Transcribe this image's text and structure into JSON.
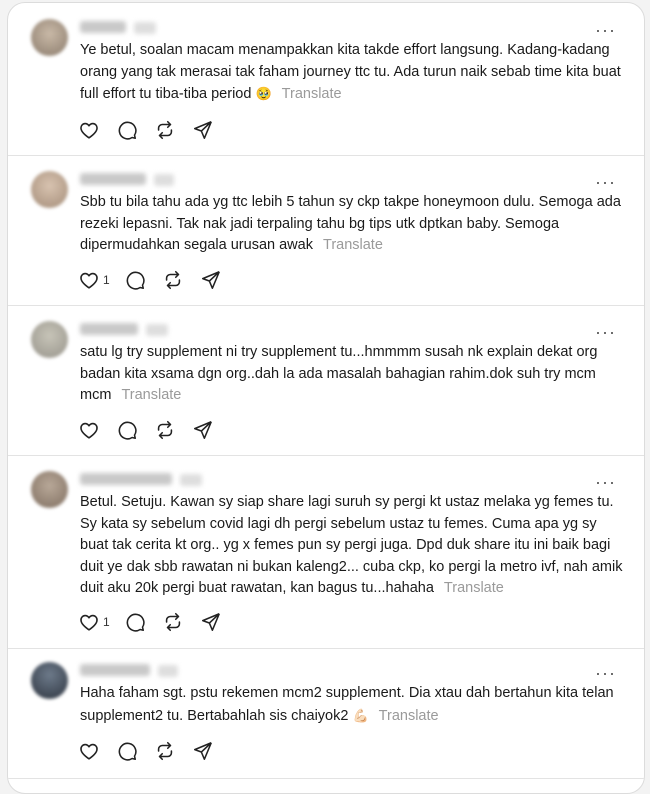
{
  "posts": [
    {
      "text": "Ye betul, soalan macam menampakkan kita takde effort langsung. Kadang-kadang orang yang tak merasai tak faham journey ttc tu. Ada turun naik sebab time kita buat full effort tu tiba-tiba period",
      "emoji": "🥹",
      "translate": "Translate",
      "like_count": ""
    },
    {
      "text": "Sbb tu bila tahu ada yg ttc lebih 5 tahun sy ckp takpe honeymoon dulu. Semoga ada rezeki lepasni. Tak nak jadi terpaling tahu bg tips utk dptkan baby. Semoga dipermudahkan segala urusan awak",
      "emoji": "",
      "translate": "Translate",
      "like_count": "1"
    },
    {
      "text": "satu lg try supplement ni try supplement tu...hmmmm susah nk explain dekat org badan kita xsama dgn org..dah la ada masalah bahagian rahim.dok suh try mcm mcm",
      "emoji": "",
      "translate": "Translate",
      "like_count": ""
    },
    {
      "text": "Betul. Setuju. Kawan sy siap share lagi suruh sy pergi kt ustaz melaka yg femes tu. Sy kata sy sebelum covid lagi dh pergi sebelum ustaz tu femes. Cuma apa yg sy buat tak cerita kt org.. yg x femes pun sy pergi juga. Dpd duk share itu ini baik bagi duit ye dak sbb rawatan ni bukan kaleng2... cuba ckp, ko pergi la metro ivf, nah amik duit aku 20k pergi buat rawatan, kan bagus tu...hahaha",
      "emoji": "",
      "translate": "Translate",
      "like_count": "1"
    },
    {
      "text": "Haha faham sgt. pstu rekemen mcm2 supplement. Dia xtau dah bertahun kita telan supplement2 tu. Bertabahlah sis chaiyok2",
      "emoji": "💪🏻",
      "translate": "Translate",
      "like_count": ""
    }
  ],
  "icons": {
    "more": "more-icon",
    "like": "heart-icon",
    "reply": "comment-icon",
    "repost": "repost-icon",
    "share": "send-icon"
  },
  "colors": {
    "translate": "#9a9a9a",
    "divider": "#e3e3e3"
  }
}
